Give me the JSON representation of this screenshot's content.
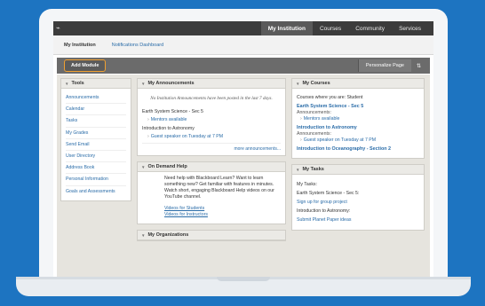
{
  "topnav": {
    "tabs": [
      {
        "label": "My Institution",
        "active": true
      },
      {
        "label": "Courses",
        "active": false
      },
      {
        "label": "Community",
        "active": false
      },
      {
        "label": "Services",
        "active": false
      }
    ]
  },
  "subtabs": [
    {
      "label": "My Institution",
      "active": true
    },
    {
      "label": "Notifications Dashboard",
      "active": false
    }
  ],
  "actionbar": {
    "add_module": "Add Module",
    "personalize": "Personalize Page",
    "sort_icon": "⇅"
  },
  "tools": {
    "title": "Tools",
    "items": [
      "Announcements",
      "Calendar",
      "Tasks",
      "My Grades",
      "Send Email",
      "User Directory",
      "Address Book",
      "Personal Information",
      "Goals and Assessments"
    ]
  },
  "announcements": {
    "title": "My Announcements",
    "empty_text": "No Institution Announcements have been posted in the last 7 days.",
    "entries": [
      {
        "course": "Earth System Science - Sec 5",
        "link": "Mentors available"
      },
      {
        "course": "Introduction to Astronomy",
        "link": "Guest speaker on Tuesday at 7 PM"
      }
    ],
    "more": "more announcements..."
  },
  "help": {
    "title": "On Demand Help",
    "text": "Need help with Blackboard Learn? Want to learn something new? Get familiar with features in minutes. Watch short, engaging Blackboard Help videos on our YouTube channel.",
    "link_students": "Videos for Students",
    "link_instructors": "Videos for Instructors"
  },
  "organizations": {
    "title": "My Organizations"
  },
  "courses": {
    "title": "My Courses",
    "intro": "Courses where you are: Student",
    "course1": "Earth System Science - Sec 5",
    "course1_sub": "Announcements:",
    "course1_link": "Mentors available",
    "course2": "Introduction to Astronomy",
    "course2_sub": "Announcements:",
    "course2_link": "Guest speaker on Tuesday at 7 PM",
    "course3": "Introduction to Oceanography - Section 2"
  },
  "tasks": {
    "title": "My Tasks",
    "line1": "My Tasks:",
    "line2": "Earth System Science - Sec 5:",
    "link1": "Sign up for group project",
    "line3": "Introduction to Astronomy:",
    "link2": "Submit Planet Paper ideas"
  },
  "colors": {
    "background": "#1d74c1",
    "link": "#2a6ca8",
    "highlight": "#f0a030"
  }
}
